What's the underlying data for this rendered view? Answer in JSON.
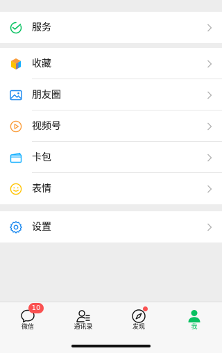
{
  "colors": {
    "background": "#ededed",
    "card": "#ffffff",
    "accent": "#07c160",
    "badge": "#fa5151",
    "chevron": "#b2b2b2"
  },
  "menu": {
    "service": {
      "label": "服务",
      "icon": "service-icon"
    },
    "favorites": {
      "label": "收藏",
      "icon": "favorites-cube-icon"
    },
    "moments": {
      "label": "朋友圈",
      "icon": "moments-image-icon"
    },
    "channels": {
      "label": "视频号",
      "icon": "channels-play-icon"
    },
    "cards": {
      "label": "卡包",
      "icon": "card-wallet-icon"
    },
    "stickers": {
      "label": "表情",
      "icon": "smile-icon"
    },
    "settings": {
      "label": "设置",
      "icon": "gear-icon"
    }
  },
  "tabbar": {
    "chats": {
      "label": "微信",
      "badge": "10",
      "icon": "chat-bubble-icon"
    },
    "contacts": {
      "label": "通讯录",
      "icon": "contacts-icon"
    },
    "discover": {
      "label": "发现",
      "icon": "compass-icon",
      "dot": true
    },
    "me": {
      "label": "我",
      "icon": "person-icon",
      "active": true
    }
  }
}
